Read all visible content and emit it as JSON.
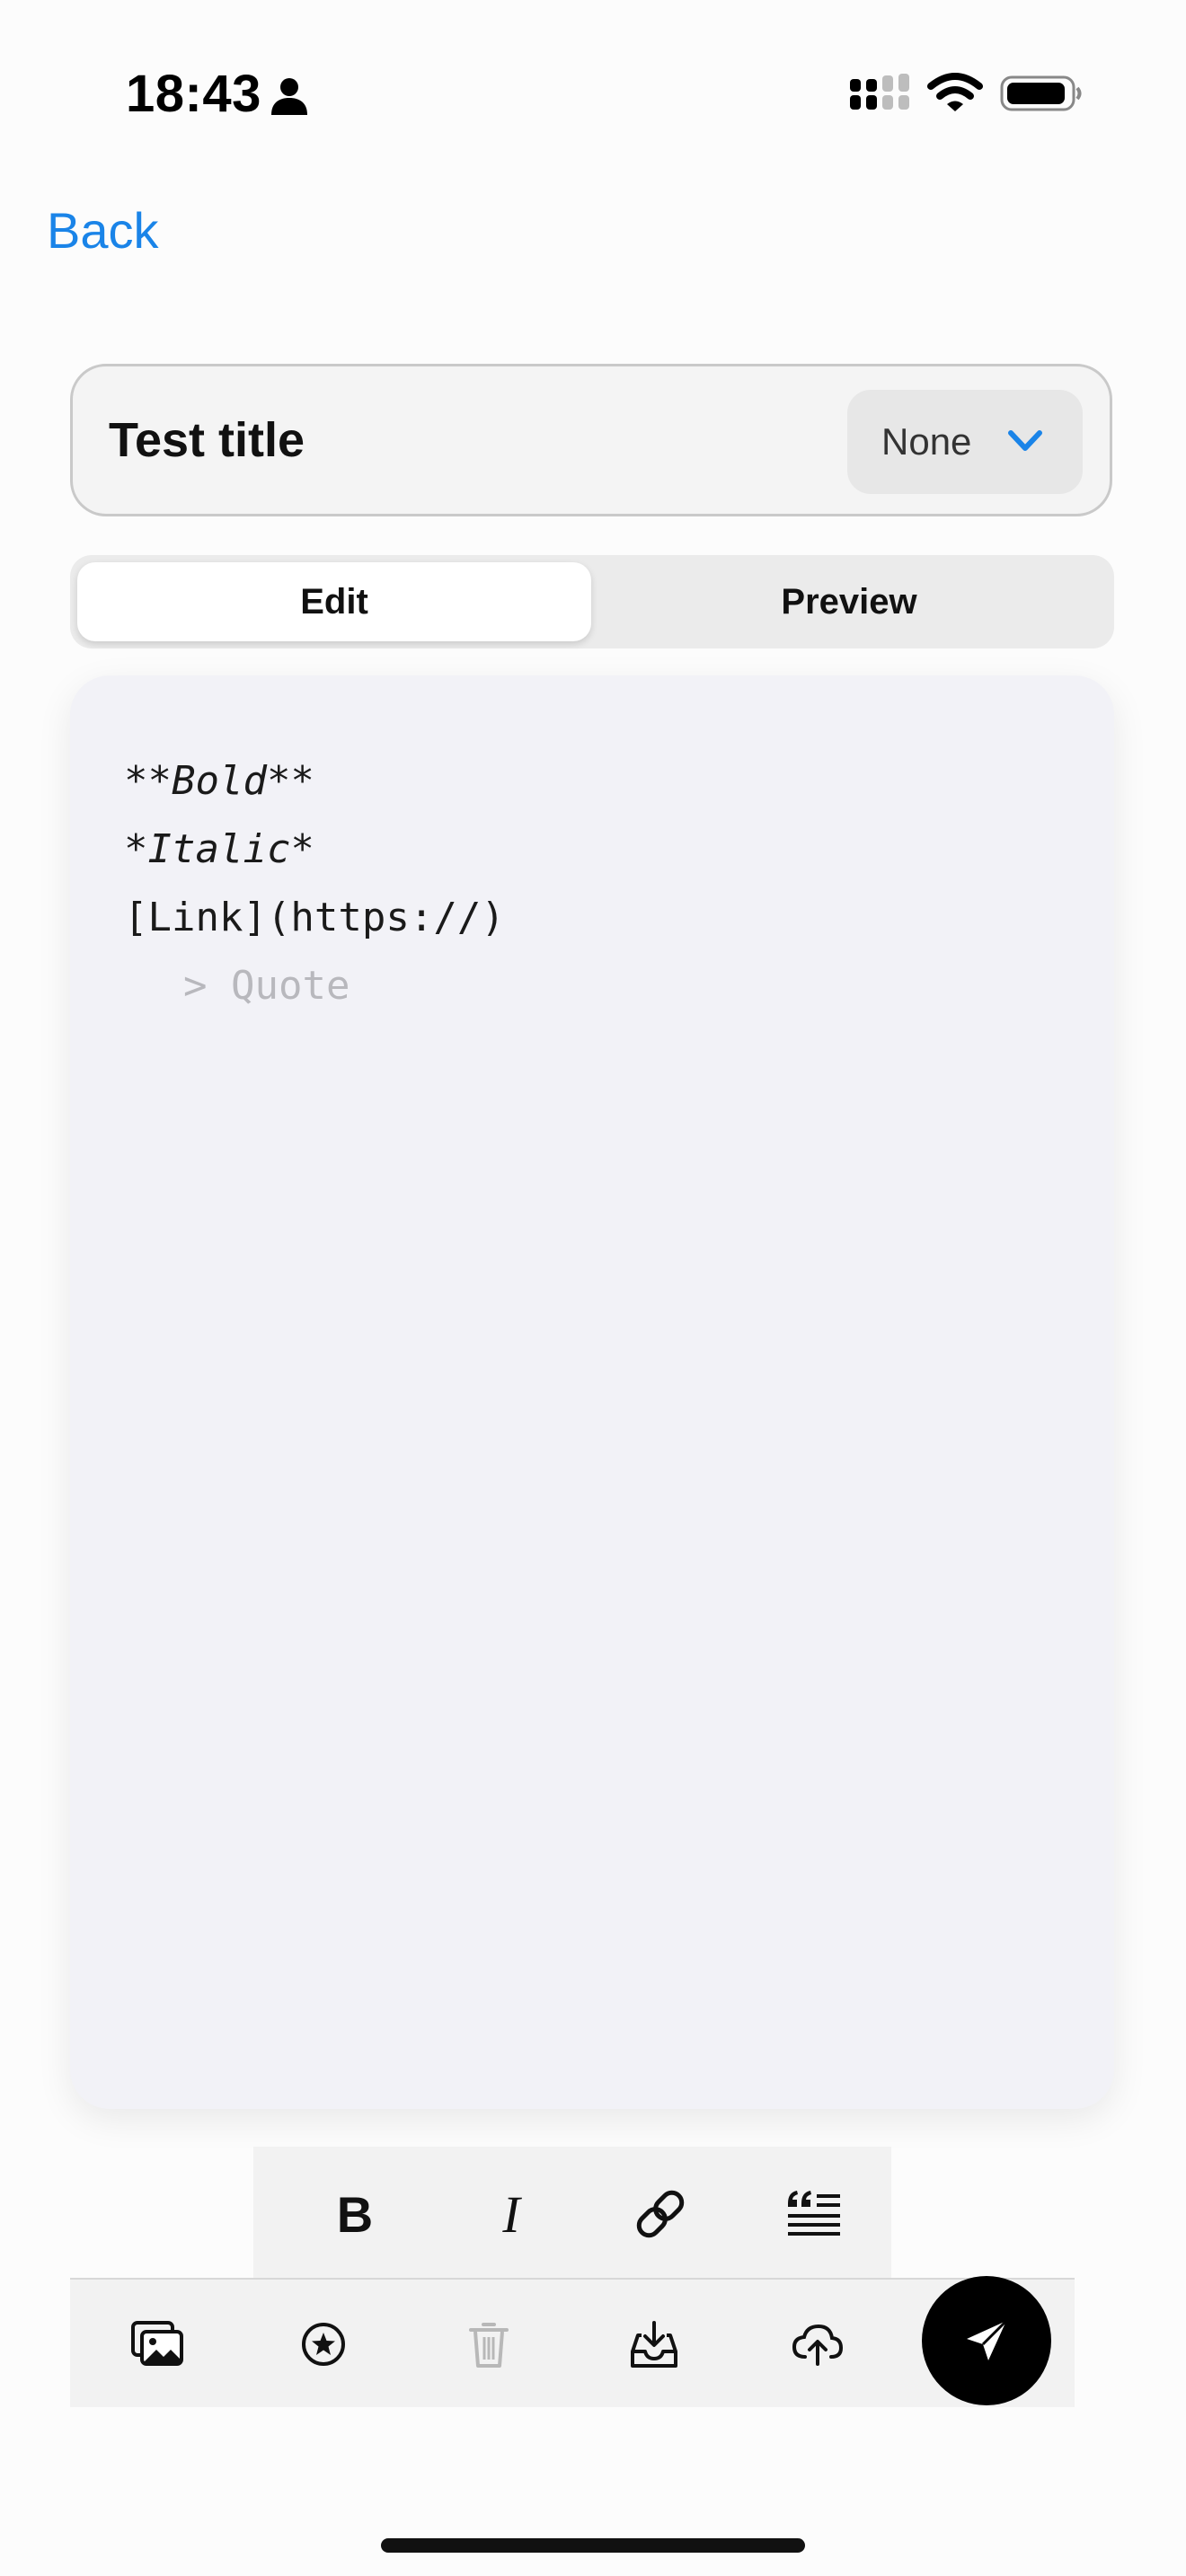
{
  "status_bar": {
    "time": "18:43",
    "icons": [
      "person-icon",
      "signal-icon",
      "wifi-icon",
      "battery-icon"
    ]
  },
  "nav": {
    "back_label": "Back"
  },
  "title_field": {
    "value": "Test title",
    "category": {
      "selected": "None",
      "icon": "chevron-down-icon"
    }
  },
  "mode_tabs": {
    "edit_label": "Edit",
    "preview_label": "Preview",
    "selected": "Edit"
  },
  "editor": {
    "lines": [
      "**Bold**",
      "*Italic*",
      "[Link](https://)"
    ],
    "placeholder": "> Quote"
  },
  "format_toolbar": {
    "bold_label": "B",
    "italic_label": "I",
    "icons": [
      "bold-icon",
      "italic-icon",
      "link-icon",
      "quote-icon"
    ]
  },
  "action_bar": {
    "icons": [
      "photo-icon",
      "star-icon",
      "trash-icon",
      "inbox-download-icon",
      "cloud-upload-icon",
      "send-icon"
    ]
  },
  "colors": {
    "accent": "#1a84e8",
    "editor_background": "#f2f2f7",
    "send_button": "#000000",
    "disabled_icon": "#b8b8b8"
  }
}
